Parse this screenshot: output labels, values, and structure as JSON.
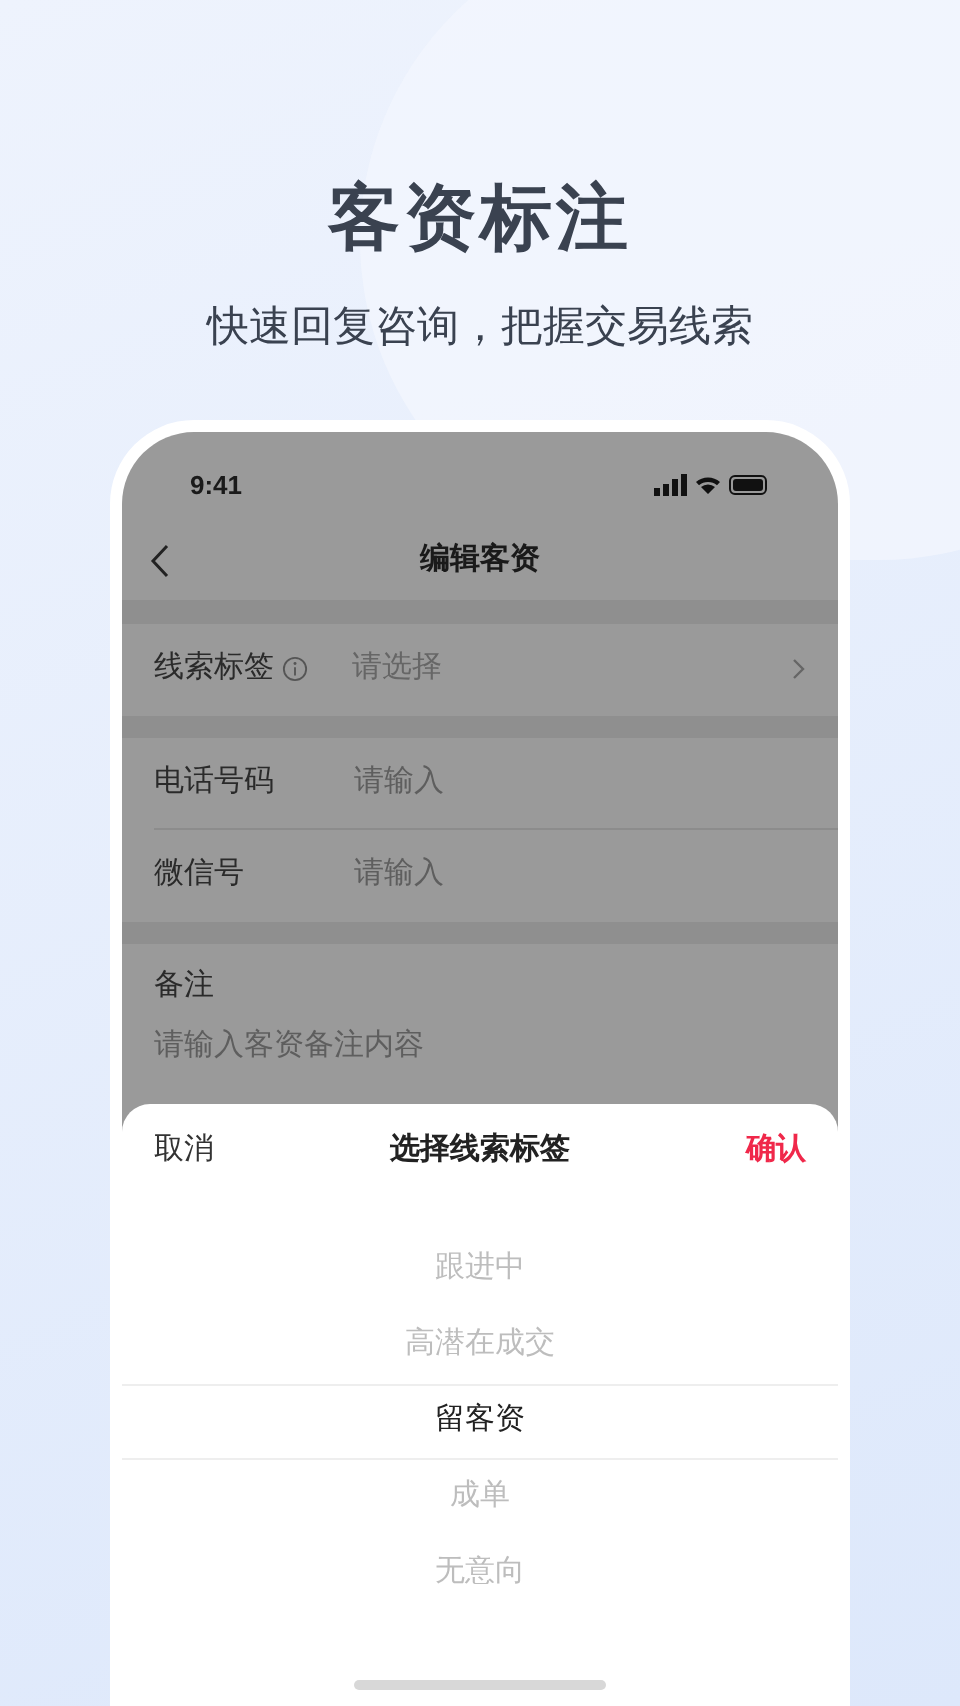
{
  "headline": "客资标注",
  "subtitle": "快速回复咨询，把握交易线索",
  "status_bar": {
    "time": "9:41"
  },
  "nav": {
    "title": "编辑客资"
  },
  "form": [
    {
      "kind": "select",
      "label": "线索标签",
      "placeholder": "请选择"
    },
    {
      "kind": "gap"
    },
    {
      "kind": "input",
      "label": "电话号码",
      "placeholder": "请输入"
    },
    {
      "kind": "input",
      "label": "微信号",
      "placeholder": "请输入"
    },
    {
      "kind": "gap"
    },
    {
      "kind": "textarea",
      "label": "备注",
      "placeholder": "请输入客资备注内容"
    }
  ],
  "sheet": {
    "cancel": "取消",
    "title": "选择线索标签",
    "confirm": "确认",
    "options": [
      {
        "label": "跟进中",
        "selected": false
      },
      {
        "label": "高潜在成交",
        "selected": false
      },
      {
        "label": "留客资",
        "selected": true
      },
      {
        "label": "成单",
        "selected": false
      },
      {
        "label": "无意向",
        "selected": false
      }
    ]
  }
}
